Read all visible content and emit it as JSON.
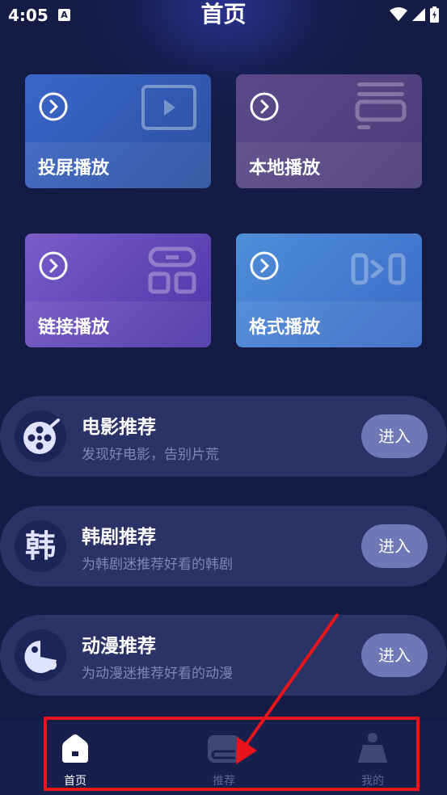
{
  "status": {
    "time": "4:05",
    "notif": "A"
  },
  "header": {
    "title": "首页"
  },
  "tiles": [
    {
      "label": "投屏播放"
    },
    {
      "label": "本地播放"
    },
    {
      "label": "链接播放"
    },
    {
      "label": "格式播放"
    }
  ],
  "cards": [
    {
      "title": "电影推荐",
      "desc": "发现好电影，告别片荒",
      "button": "进入",
      "icon": "film-reel-icon"
    },
    {
      "title": "韩剧推荐",
      "desc": "为韩剧迷推荐好看的韩剧",
      "button": "进入",
      "icon": "han-character-icon",
      "icon_text": "韩"
    },
    {
      "title": "动漫推荐",
      "desc": "为动漫迷推荐好看的动漫",
      "button": "进入",
      "icon": "anime-icon"
    }
  ],
  "nav": {
    "items": [
      {
        "label": "首页",
        "active": true
      },
      {
        "label": "推荐",
        "active": false
      },
      {
        "label": "我的",
        "active": false
      }
    ]
  },
  "colors": {
    "background": "#141c45",
    "annotation": "#e8141c",
    "nav_inactive": "#5d6594"
  }
}
